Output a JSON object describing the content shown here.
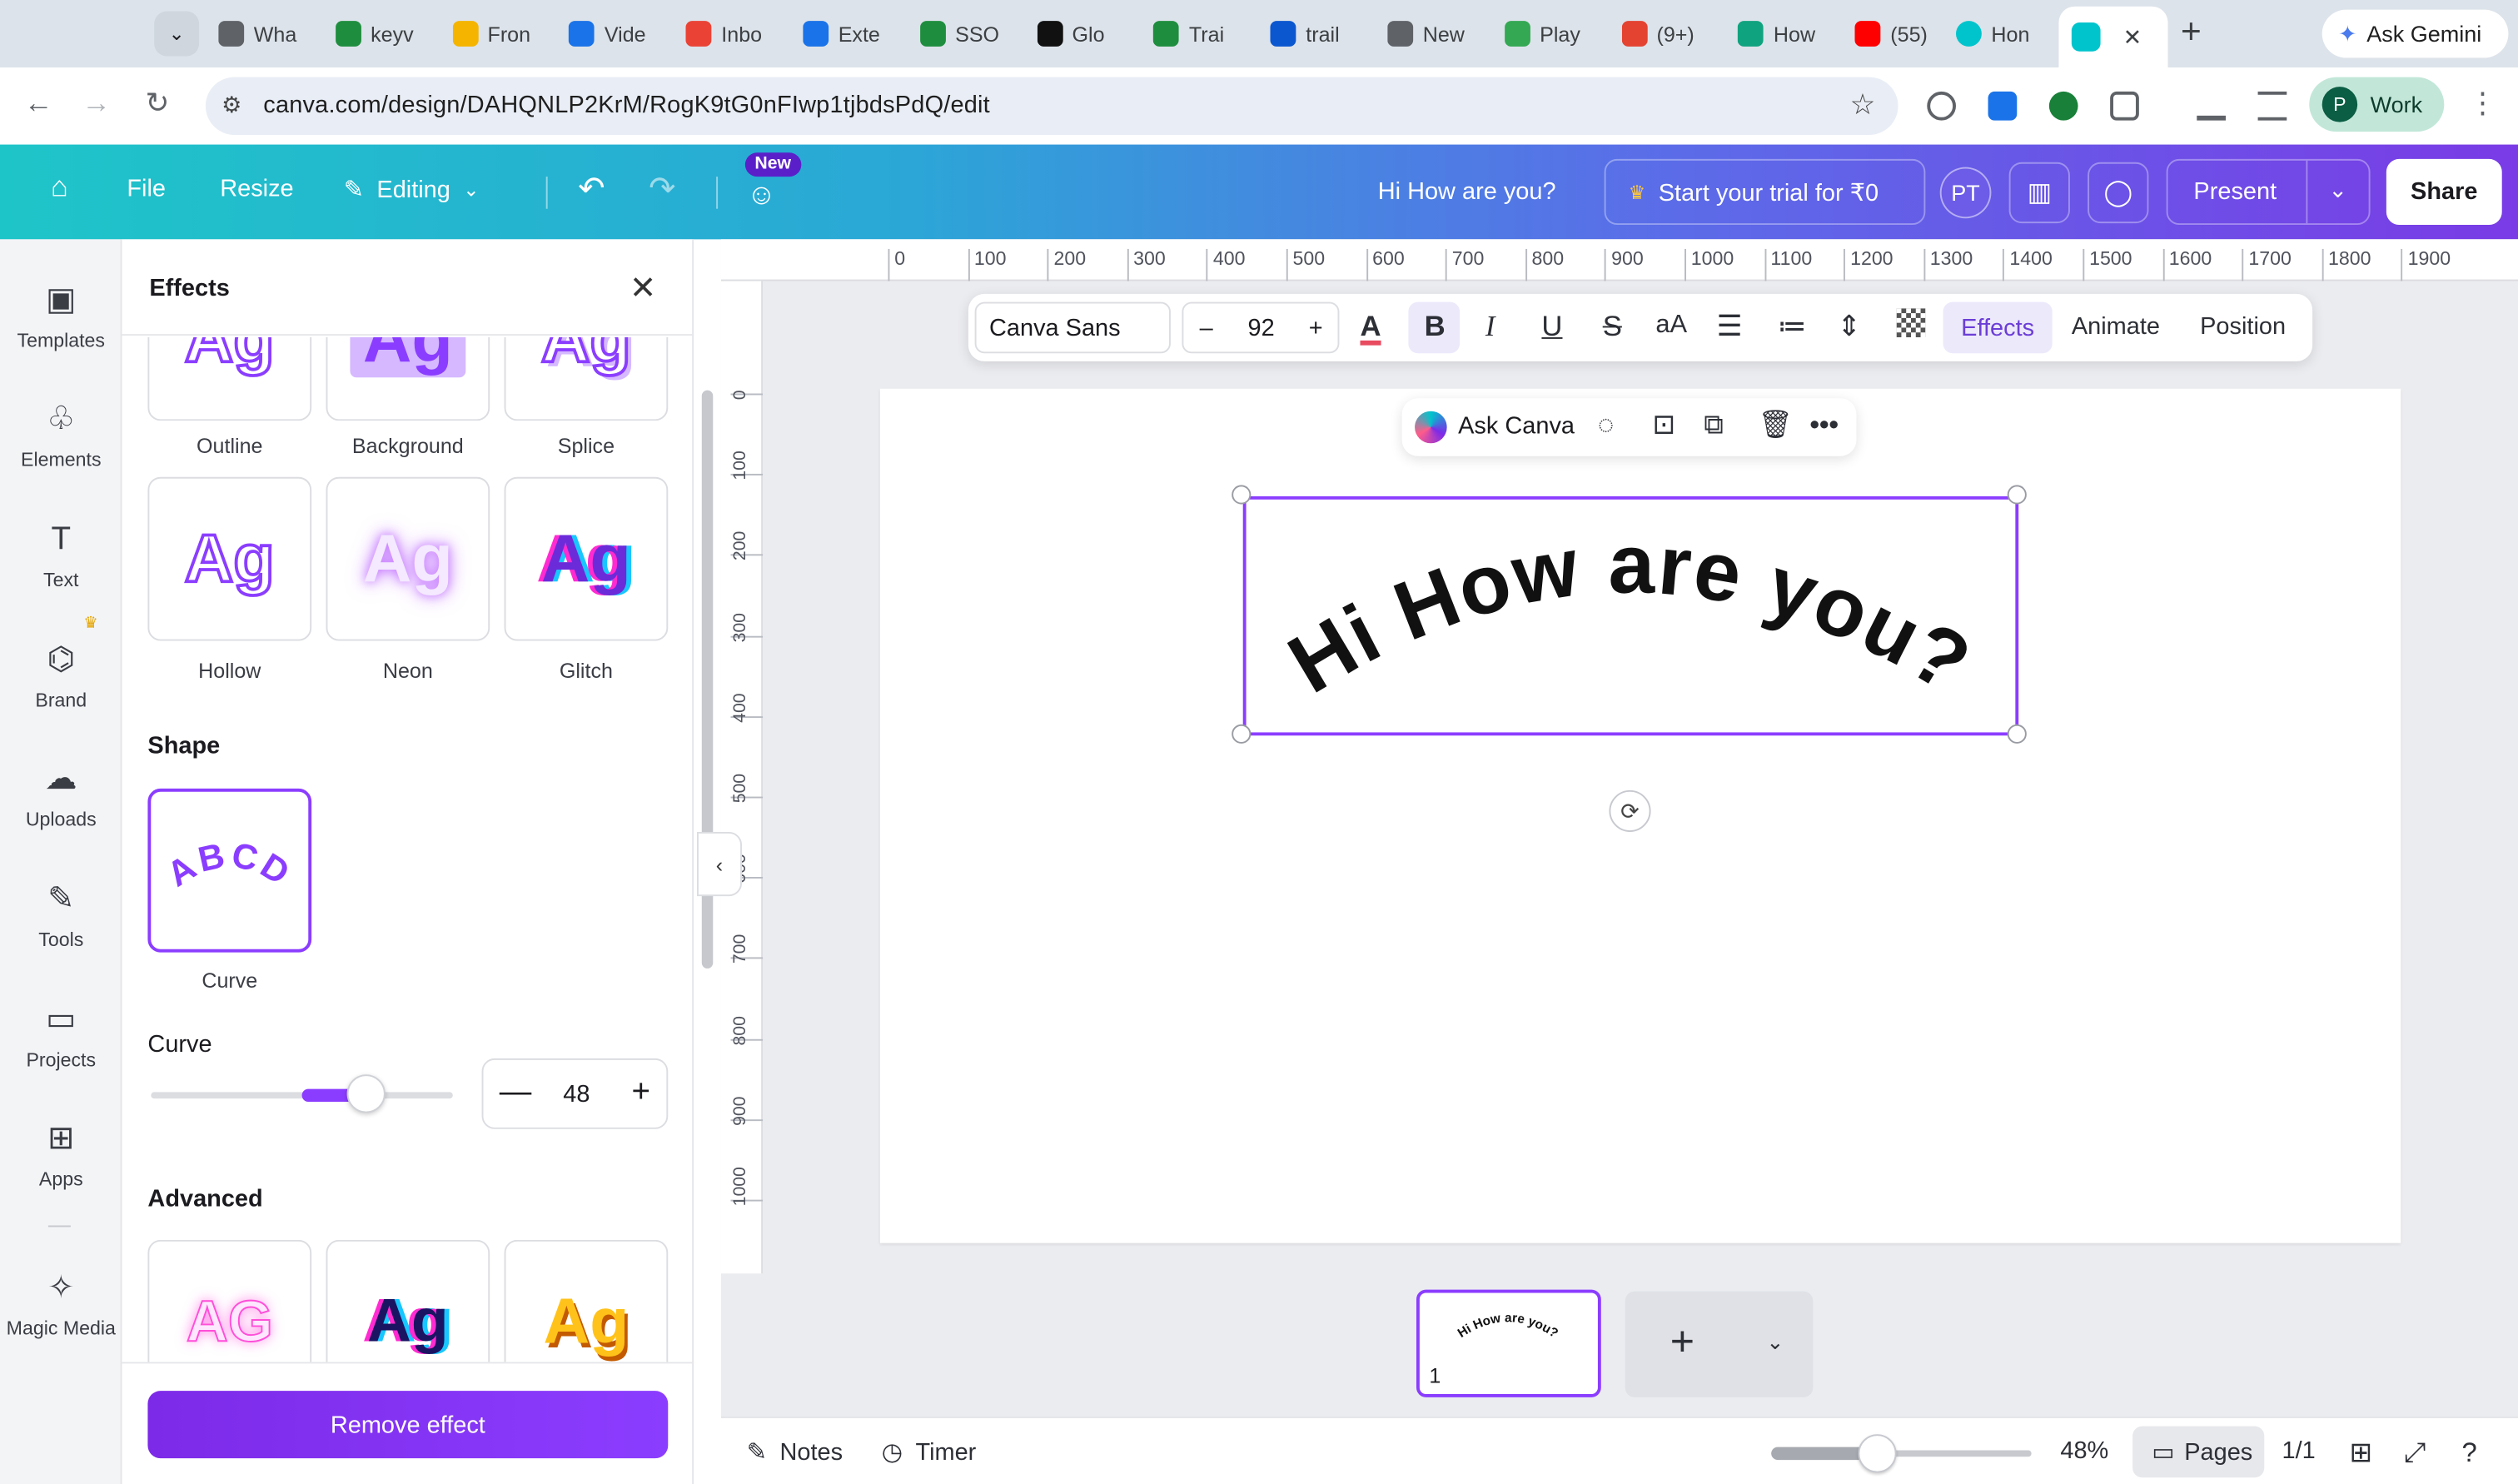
{
  "browser": {
    "tabs": [
      {
        "label": "Wha",
        "icon": "chrome-icon",
        "color": "#5f6368"
      },
      {
        "label": "keyv",
        "icon": "sheets-icon",
        "color": "#1e8e3e"
      },
      {
        "label": "Fron",
        "icon": "drive-icon",
        "color": "#f4b400"
      },
      {
        "label": "Vide",
        "icon": "video-icon",
        "color": "#1a73e8"
      },
      {
        "label": "Inbo",
        "icon": "gmail-icon",
        "color": "#ea4335"
      },
      {
        "label": "Exte",
        "icon": "puzzle-icon",
        "color": "#1a73e8"
      },
      {
        "label": "SSO",
        "icon": "sheets-icon",
        "color": "#1e8e3e"
      },
      {
        "label": "Glo",
        "icon": "notion-icon",
        "color": "#111111"
      },
      {
        "label": "Trai",
        "icon": "sheets-icon",
        "color": "#1e8e3e"
      },
      {
        "label": "trail",
        "icon": "circle-icon",
        "color": "#0b57d0"
      },
      {
        "label": "New",
        "icon": "chrome-icon",
        "color": "#5f6368"
      },
      {
        "label": "Play",
        "icon": "play-icon",
        "color": "#34a853"
      },
      {
        "label": "(9+)",
        "icon": "todoist-icon",
        "color": "#e44332"
      },
      {
        "label": "How",
        "icon": "chatgpt-icon",
        "color": "#10a37f"
      },
      {
        "label": "(55)",
        "icon": "youtube-icon",
        "color": "#ff0000"
      },
      {
        "label": "Hon",
        "icon": "canva-icon",
        "color": "#00c4cc"
      }
    ],
    "gemini_label": "Ask Gemini",
    "url": "canva.com/design/DAHQNLP2KrM/RogK9tG0nFIwp1tjbdsPdQ/edit",
    "profile_label": "Work",
    "profile_initial": "P"
  },
  "header": {
    "file": "File",
    "resize": "Resize",
    "editing": "Editing",
    "new_badge": "New",
    "title": "Hi How are you?",
    "trial": "Start your trial for ₹0",
    "avatar": "PT",
    "present": "Present",
    "share": "Share"
  },
  "rail": {
    "items": [
      "Templates",
      "Elements",
      "Text",
      "Brand",
      "Uploads",
      "Tools",
      "Projects",
      "Apps",
      "Magic Media"
    ]
  },
  "panel": {
    "title": "Effects",
    "styles_row1": [
      "Outline",
      "Background",
      "Splice"
    ],
    "styles_row2": [
      "Hollow",
      "Neon",
      "Glitch"
    ],
    "preview_text": "Ag",
    "shape_heading": "Shape",
    "shape_preview": "ABCD",
    "shape_label": "Curve",
    "curve_label": "Curve",
    "curve_value": "48",
    "curve_fraction": 0.74,
    "advanced_heading": "Advanced",
    "advanced_previews": [
      "AG",
      "Ag",
      "Ag"
    ],
    "remove_label": "Remove effect"
  },
  "toolbar": {
    "font": "Canva Sans",
    "size": "92",
    "minus": "–",
    "plus": "+",
    "effects": "Effects",
    "animate": "Animate",
    "position": "Position"
  },
  "askbar": {
    "label": "Ask Canva"
  },
  "rulers": {
    "horizontal": [
      "0",
      "100",
      "200",
      "300",
      "400",
      "500",
      "600",
      "700",
      "800",
      "900",
      "1000",
      "1100",
      "1200",
      "1300",
      "1400",
      "1500",
      "1600",
      "1700",
      "1800",
      "1900"
    ],
    "vertical": [
      "0",
      "100",
      "200",
      "300",
      "400",
      "500",
      "600",
      "700",
      "800",
      "900",
      "1000"
    ]
  },
  "canvas": {
    "text": "Hi How are you?"
  },
  "pages": {
    "thumb_number": "1",
    "thumb_text": "Hi How are you?"
  },
  "footer": {
    "notes": "Notes",
    "timer": "Timer",
    "zoom": "48%",
    "pages": "Pages",
    "page_count": "1/1"
  },
  "colors": {
    "accent": "#8b3dff",
    "header_start": "#1ec5c8",
    "header_end": "#7a3be6"
  }
}
